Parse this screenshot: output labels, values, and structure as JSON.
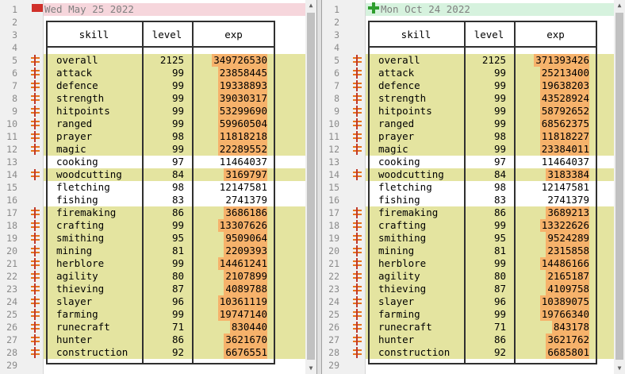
{
  "left": {
    "date": "Wed May 25 2022",
    "headers": {
      "skill": "skill",
      "level": "level",
      "exp": "exp"
    },
    "rows": [
      {
        "skill": "overall",
        "level": "2125",
        "exp": "349726530",
        "changed": true
      },
      {
        "skill": "attack",
        "level": "99",
        "exp": "23858445",
        "changed": true
      },
      {
        "skill": "defence",
        "level": "99",
        "exp": "19338893",
        "changed": true
      },
      {
        "skill": "strength",
        "level": "99",
        "exp": "39030317",
        "changed": true
      },
      {
        "skill": "hitpoints",
        "level": "99",
        "exp": "53299690",
        "changed": true
      },
      {
        "skill": "ranged",
        "level": "99",
        "exp": "59960504",
        "changed": true
      },
      {
        "skill": "prayer",
        "level": "98",
        "exp": "11818218",
        "changed": true
      },
      {
        "skill": "magic",
        "level": "99",
        "exp": "22289552",
        "changed": true
      },
      {
        "skill": "cooking",
        "level": "97",
        "exp": "11464037",
        "changed": false
      },
      {
        "skill": "woodcutting",
        "level": "84",
        "exp": "3169797",
        "changed": true
      },
      {
        "skill": "fletching",
        "level": "98",
        "exp": "12147581",
        "changed": false
      },
      {
        "skill": "fishing",
        "level": "83",
        "exp": "2741379",
        "changed": false
      },
      {
        "skill": "firemaking",
        "level": "86",
        "exp": "3686186",
        "changed": true
      },
      {
        "skill": "crafting",
        "level": "99",
        "exp": "13307626",
        "changed": true
      },
      {
        "skill": "smithing",
        "level": "95",
        "exp": "9509064",
        "changed": true
      },
      {
        "skill": "mining",
        "level": "81",
        "exp": "2209393",
        "changed": true
      },
      {
        "skill": "herblore",
        "level": "99",
        "exp": "14461241",
        "changed": true
      },
      {
        "skill": "agility",
        "level": "80",
        "exp": "2107899",
        "changed": true
      },
      {
        "skill": "thieving",
        "level": "87",
        "exp": "4089788",
        "changed": true
      },
      {
        "skill": "slayer",
        "level": "96",
        "exp": "10361119",
        "changed": true
      },
      {
        "skill": "farming",
        "level": "99",
        "exp": "19747140",
        "changed": true
      },
      {
        "skill": "runecraft",
        "level": "71",
        "exp": "830440",
        "changed": true
      },
      {
        "skill": "hunter",
        "level": "86",
        "exp": "3621670",
        "changed": true
      },
      {
        "skill": "construction",
        "level": "92",
        "exp": "6676551",
        "changed": true
      }
    ]
  },
  "right": {
    "date": "Mon Oct 24 2022",
    "headers": {
      "skill": "skill",
      "level": "level",
      "exp": "exp"
    },
    "rows": [
      {
        "skill": "overall",
        "level": "2125",
        "exp": "371393426",
        "changed": true
      },
      {
        "skill": "attack",
        "level": "99",
        "exp": "25213400",
        "changed": true
      },
      {
        "skill": "defence",
        "level": "99",
        "exp": "19638203",
        "changed": true
      },
      {
        "skill": "strength",
        "level": "99",
        "exp": "43528924",
        "changed": true
      },
      {
        "skill": "hitpoints",
        "level": "99",
        "exp": "58792652",
        "changed": true
      },
      {
        "skill": "ranged",
        "level": "99",
        "exp": "68562375",
        "changed": true
      },
      {
        "skill": "prayer",
        "level": "98",
        "exp": "11818227",
        "changed": true
      },
      {
        "skill": "magic",
        "level": "99",
        "exp": "23384011",
        "changed": true
      },
      {
        "skill": "cooking",
        "level": "97",
        "exp": "11464037",
        "changed": false
      },
      {
        "skill": "woodcutting",
        "level": "84",
        "exp": "3183384",
        "changed": true
      },
      {
        "skill": "fletching",
        "level": "98",
        "exp": "12147581",
        "changed": false
      },
      {
        "skill": "fishing",
        "level": "83",
        "exp": "2741379",
        "changed": false
      },
      {
        "skill": "firemaking",
        "level": "86",
        "exp": "3689213",
        "changed": true
      },
      {
        "skill": "crafting",
        "level": "99",
        "exp": "13322626",
        "changed": true
      },
      {
        "skill": "smithing",
        "level": "95",
        "exp": "9524289",
        "changed": true
      },
      {
        "skill": "mining",
        "level": "81",
        "exp": "2315858",
        "changed": true
      },
      {
        "skill": "herblore",
        "level": "99",
        "exp": "14486166",
        "changed": true
      },
      {
        "skill": "agility",
        "level": "80",
        "exp": "2165187",
        "changed": true
      },
      {
        "skill": "thieving",
        "level": "87",
        "exp": "4109758",
        "changed": true
      },
      {
        "skill": "slayer",
        "level": "96",
        "exp": "10389075",
        "changed": true
      },
      {
        "skill": "farming",
        "level": "99",
        "exp": "19766340",
        "changed": true
      },
      {
        "skill": "runecraft",
        "level": "71",
        "exp": "843178",
        "changed": true
      },
      {
        "skill": "hunter",
        "level": "86",
        "exp": "3621762",
        "changed": true
      },
      {
        "skill": "construction",
        "level": "92",
        "exp": "6685801",
        "changed": true
      }
    ]
  },
  "line_numbers": [
    "1",
    "2",
    "3",
    "4",
    "5",
    "6",
    "7",
    "8",
    "9",
    "10",
    "11",
    "12",
    "13",
    "14",
    "15",
    "16",
    "17",
    "18",
    "19",
    "20",
    "21",
    "22",
    "23",
    "24",
    "25",
    "26",
    "27",
    "28",
    "29"
  ],
  "colors": {
    "changed_line": "#e4e4a0",
    "changed_value": "#f6b26b",
    "removed_marker": "#d0302a",
    "added_marker": "#2e9e2e"
  }
}
